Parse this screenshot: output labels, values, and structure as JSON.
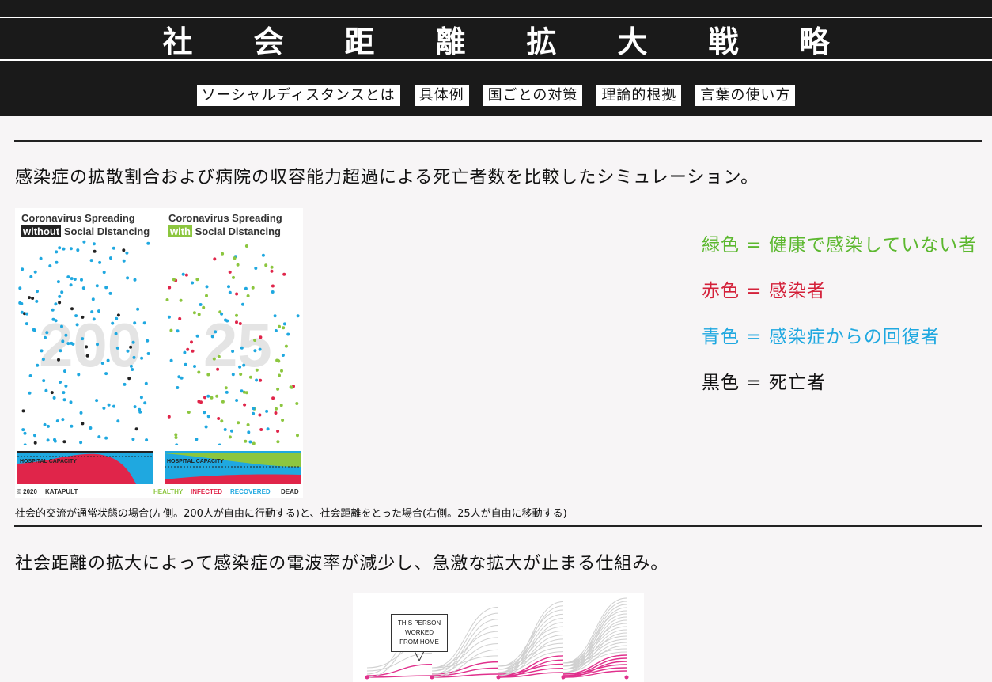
{
  "header": {
    "title": "社会距離拡大戦略",
    "nav": [
      "ソーシャルディスタンスとは",
      "具体例",
      "国ごとの対策",
      "理論的根拠",
      "言葉の使い方"
    ]
  },
  "section1": {
    "lead": "感染症の拡散割合および病院の収容能力超過による死亡者数を比較したシミュレーション。",
    "figure": {
      "left_panel": {
        "title_line1": "Coronavirus Spreading",
        "title_highlight": "without",
        "title_rest": " Social Distancing",
        "number": "200",
        "capacity_label": "HOSPITAL CAPACITY"
      },
      "right_panel": {
        "title_line1": "Coronavirus Spreading",
        "title_highlight": "with",
        "title_rest": " Social Distancing",
        "number": "25",
        "capacity_label": "HOSPITAL CAPACITY"
      },
      "credit": "© 2020",
      "brand": "KATAPULT",
      "legend_words": [
        "HEALTHY",
        "INFECTED",
        "RECOVERED",
        "DEAD"
      ]
    },
    "legend": [
      {
        "text": "緑色 = 健康で感染していない者",
        "color": "#5cb82f"
      },
      {
        "text": "赤色 = 感染者",
        "color": "#d4213a"
      },
      {
        "text": "青色 = 感染症からの回復者",
        "color": "#1fa8e0"
      },
      {
        "text": "黒色 = 死亡者",
        "color": "#111111"
      }
    ],
    "caption": "社会的交流が通常状態の場合(左側。200人が自由に行動する)と、社会距離をとった場合(右側。25人が自由に移動する)"
  },
  "section2": {
    "lead": "社会距離の拡大によって感染症の電波率が減少し、急激な拡大が止まる仕組み。",
    "figure_note": [
      "THIS PERSON",
      "WORKED",
      "FROM HOME"
    ]
  },
  "colors": {
    "green": "#8cc63f",
    "red": "#e0254a",
    "blue": "#1fa8e0",
    "black": "#222222",
    "dark": "#1a1a1a"
  }
}
